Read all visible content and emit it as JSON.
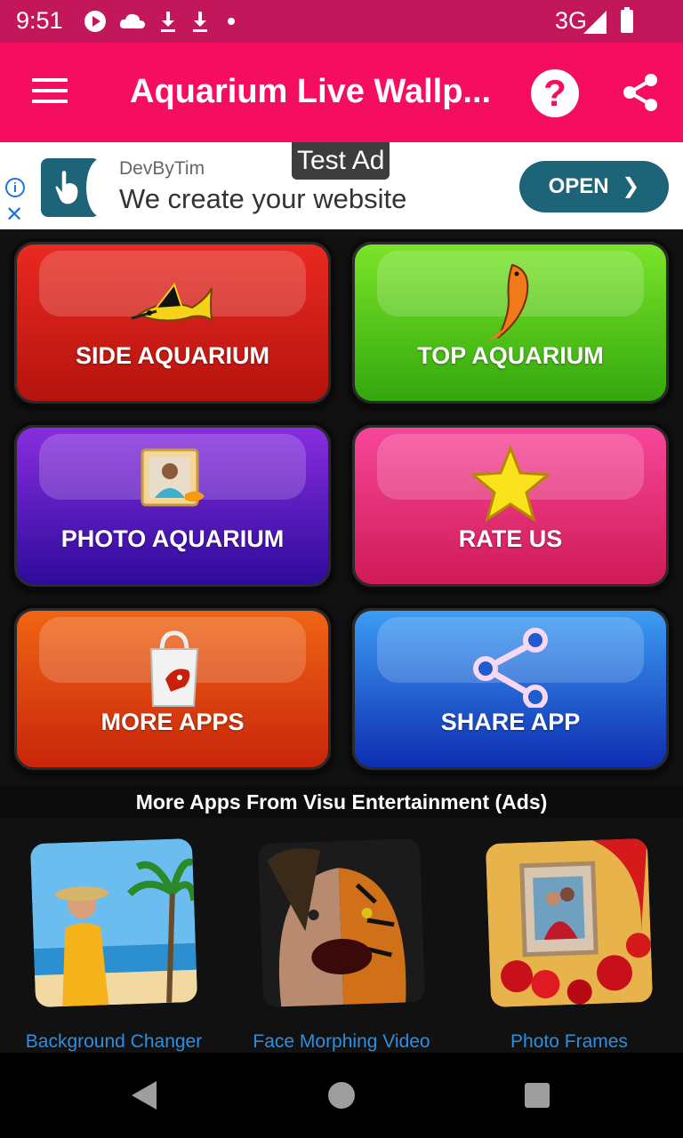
{
  "status_bar": {
    "time": "9:51",
    "network": "3G"
  },
  "app_bar": {
    "title": "Aquarium Live Wallp...",
    "help_label": "?"
  },
  "ad": {
    "tag": "Test Ad",
    "sponsor": "DevByTim",
    "text": "We create your website",
    "cta": "OPEN",
    "info_label": "i",
    "close_label": "✕"
  },
  "tiles": {
    "side": "SIDE AQUARIUM",
    "top": "TOP AQUARIUM",
    "photo": "PHOTO AQUARIUM",
    "rate": "RATE US",
    "more": "MORE APPS",
    "share": "SHARE APP"
  },
  "more_apps": {
    "header": "More Apps From Visu Entertainment (Ads)",
    "items": [
      {
        "name": "Background Changer"
      },
      {
        "name": "Face Morphing Video"
      },
      {
        "name": "Photo Frames"
      }
    ]
  },
  "colors": {
    "status": "#c2185b",
    "app_bar": "#f50d5f",
    "ad_accent": "#1d6479",
    "link": "#2e8fe0"
  }
}
